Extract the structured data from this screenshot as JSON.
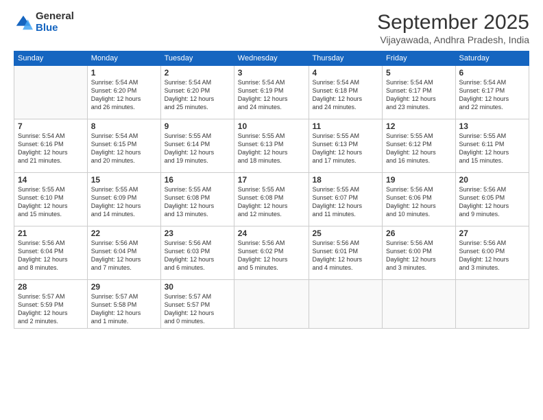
{
  "logo": {
    "general": "General",
    "blue": "Blue"
  },
  "header": {
    "month": "September 2025",
    "location": "Vijayawada, Andhra Pradesh, India"
  },
  "weekdays": [
    "Sunday",
    "Monday",
    "Tuesday",
    "Wednesday",
    "Thursday",
    "Friday",
    "Saturday"
  ],
  "weeks": [
    [
      {
        "day": null
      },
      {
        "day": 1,
        "sunrise": "5:54 AM",
        "sunset": "6:20 PM",
        "daylight": "12 hours and 26 minutes."
      },
      {
        "day": 2,
        "sunrise": "5:54 AM",
        "sunset": "6:20 PM",
        "daylight": "12 hours and 25 minutes."
      },
      {
        "day": 3,
        "sunrise": "5:54 AM",
        "sunset": "6:19 PM",
        "daylight": "12 hours and 24 minutes."
      },
      {
        "day": 4,
        "sunrise": "5:54 AM",
        "sunset": "6:18 PM",
        "daylight": "12 hours and 24 minutes."
      },
      {
        "day": 5,
        "sunrise": "5:54 AM",
        "sunset": "6:17 PM",
        "daylight": "12 hours and 23 minutes."
      },
      {
        "day": 6,
        "sunrise": "5:54 AM",
        "sunset": "6:17 PM",
        "daylight": "12 hours and 22 minutes."
      }
    ],
    [
      {
        "day": 7,
        "sunrise": "5:54 AM",
        "sunset": "6:16 PM",
        "daylight": "12 hours and 21 minutes."
      },
      {
        "day": 8,
        "sunrise": "5:54 AM",
        "sunset": "6:15 PM",
        "daylight": "12 hours and 20 minutes."
      },
      {
        "day": 9,
        "sunrise": "5:55 AM",
        "sunset": "6:14 PM",
        "daylight": "12 hours and 19 minutes."
      },
      {
        "day": 10,
        "sunrise": "5:55 AM",
        "sunset": "6:13 PM",
        "daylight": "12 hours and 18 minutes."
      },
      {
        "day": 11,
        "sunrise": "5:55 AM",
        "sunset": "6:13 PM",
        "daylight": "12 hours and 17 minutes."
      },
      {
        "day": 12,
        "sunrise": "5:55 AM",
        "sunset": "6:12 PM",
        "daylight": "12 hours and 16 minutes."
      },
      {
        "day": 13,
        "sunrise": "5:55 AM",
        "sunset": "6:11 PM",
        "daylight": "12 hours and 15 minutes."
      }
    ],
    [
      {
        "day": 14,
        "sunrise": "5:55 AM",
        "sunset": "6:10 PM",
        "daylight": "12 hours and 15 minutes."
      },
      {
        "day": 15,
        "sunrise": "5:55 AM",
        "sunset": "6:09 PM",
        "daylight": "12 hours and 14 minutes."
      },
      {
        "day": 16,
        "sunrise": "5:55 AM",
        "sunset": "6:08 PM",
        "daylight": "12 hours and 13 minutes."
      },
      {
        "day": 17,
        "sunrise": "5:55 AM",
        "sunset": "6:08 PM",
        "daylight": "12 hours and 12 minutes."
      },
      {
        "day": 18,
        "sunrise": "5:55 AM",
        "sunset": "6:07 PM",
        "daylight": "12 hours and 11 minutes."
      },
      {
        "day": 19,
        "sunrise": "5:56 AM",
        "sunset": "6:06 PM",
        "daylight": "12 hours and 10 minutes."
      },
      {
        "day": 20,
        "sunrise": "5:56 AM",
        "sunset": "6:05 PM",
        "daylight": "12 hours and 9 minutes."
      }
    ],
    [
      {
        "day": 21,
        "sunrise": "5:56 AM",
        "sunset": "6:04 PM",
        "daylight": "12 hours and 8 minutes."
      },
      {
        "day": 22,
        "sunrise": "5:56 AM",
        "sunset": "6:04 PM",
        "daylight": "12 hours and 7 minutes."
      },
      {
        "day": 23,
        "sunrise": "5:56 AM",
        "sunset": "6:03 PM",
        "daylight": "12 hours and 6 minutes."
      },
      {
        "day": 24,
        "sunrise": "5:56 AM",
        "sunset": "6:02 PM",
        "daylight": "12 hours and 5 minutes."
      },
      {
        "day": 25,
        "sunrise": "5:56 AM",
        "sunset": "6:01 PM",
        "daylight": "12 hours and 4 minutes."
      },
      {
        "day": 26,
        "sunrise": "5:56 AM",
        "sunset": "6:00 PM",
        "daylight": "12 hours and 3 minutes."
      },
      {
        "day": 27,
        "sunrise": "5:56 AM",
        "sunset": "6:00 PM",
        "daylight": "12 hours and 3 minutes."
      }
    ],
    [
      {
        "day": 28,
        "sunrise": "5:57 AM",
        "sunset": "5:59 PM",
        "daylight": "12 hours and 2 minutes."
      },
      {
        "day": 29,
        "sunrise": "5:57 AM",
        "sunset": "5:58 PM",
        "daylight": "12 hours and 1 minute."
      },
      {
        "day": 30,
        "sunrise": "5:57 AM",
        "sunset": "5:57 PM",
        "daylight": "12 hours and 0 minutes."
      },
      {
        "day": null
      },
      {
        "day": null
      },
      {
        "day": null
      },
      {
        "day": null
      }
    ]
  ]
}
